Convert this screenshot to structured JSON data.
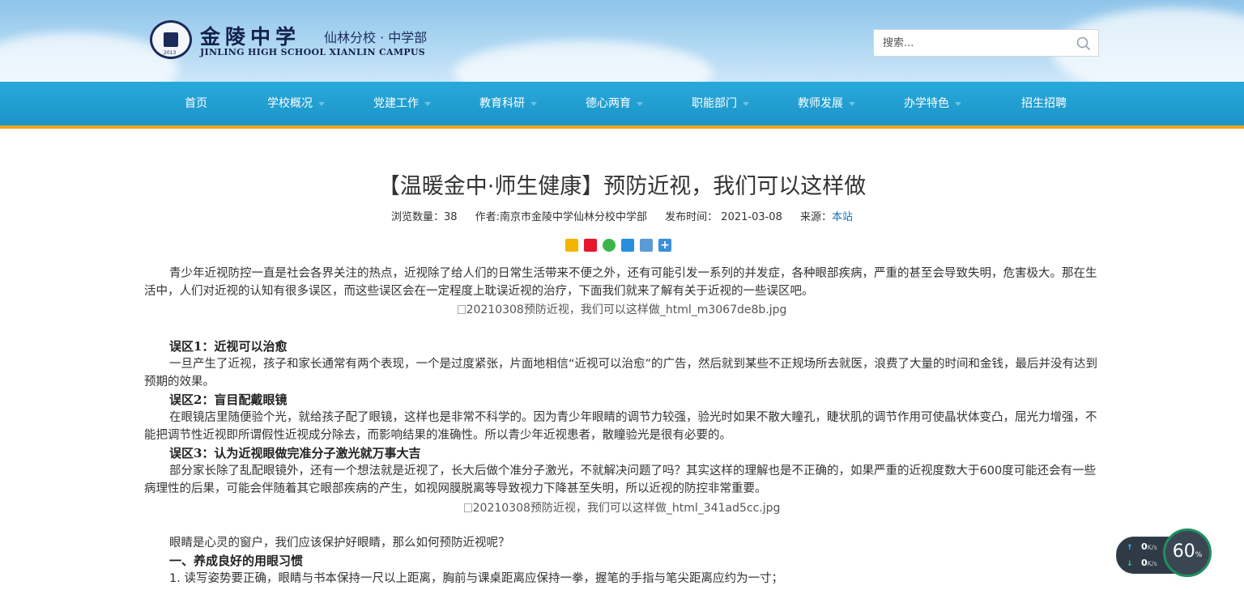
{
  "header": {
    "logo_cn": "金陵中学",
    "logo_sub": "仙林分校 · 中学部",
    "logo_en": "JINLING HIGH SCHOOL XIANLIN CAMPUS",
    "seal_year": "2013",
    "search_placeholder": "搜索..."
  },
  "nav": {
    "items": [
      {
        "label": "首页"
      },
      {
        "label": "学校概况"
      },
      {
        "label": "党建工作"
      },
      {
        "label": "教育科研"
      },
      {
        "label": "德心两育"
      },
      {
        "label": "职能部门"
      },
      {
        "label": "教师发展"
      },
      {
        "label": "办学特色"
      },
      {
        "label": "招生招聘"
      }
    ]
  },
  "article": {
    "title": "【温暖金中·师生健康】预防近视，我们可以这样做",
    "meta": {
      "views": "浏览数量：38",
      "author": "作者:南京市金陵中学仙林分校中学部",
      "date": "发布时间： 2021-03-08",
      "source_label": "来源：",
      "source_link": "本站"
    },
    "intro": "青少年近视防控一直是社会各界关注的热点，近视除了给人们的日常生活带来不便之外，还有可能引发一系列的并发症，各种眼部疾病，严重的甚至会导致失明，危害极大。那在生活中，人们对近视的认知有很多误区，而这些误区会在一定程度上耽误近视的治疗，下面我们就来了解有关于近视的一些误区吧。",
    "image1_alt": "20210308预防近视，我们可以这样做_html_m3067de8b.jpg",
    "myth1_title": "误区1：近视可以治愈",
    "myth1_text": "一旦产生了近视，孩子和家长通常有两个表现，一个是过度紧张，片面地相信“近视可以治愈”的广告，然后就到某些不正规场所去就医，浪费了大量的时间和金钱，最后并没有达到预期的效果。",
    "myth2_title": "误区2：盲目配戴眼镜",
    "myth2_text": "在眼镜店里随便验个光，就给孩子配了眼镜，这样也是非常不科学的。因为青少年眼睛的调节力较强，验光时如果不散大瞳孔，睫状肌的调节作用可使晶状体变凸，屈光力增强，不能把调节性近视即所谓假性近视成分除去，而影响结果的准确性。所以青少年近视患者，散瞳验光是很有必要的。",
    "myth3_title": "误区3：认为近视眼做完准分子激光就万事大吉",
    "myth3_text": "部分家长除了乱配眼镜外，还有一个想法就是近视了，长大后做个准分子激光，不就解决问题了吗？其实这样的理解也是不正确的，如果严重的近视度数大于600度可能还会有一些病理性的后果，可能会伴随着其它眼部疾病的产生，如视网膜脱离等导致视力下降甚至失明，所以近视的防控非常重要。",
    "image2_alt": "20210308预防近视，我们可以这样做_html_341ad5cc.jpg",
    "question": "眼睛是心灵的窗户，我们应该保护好眼睛，那么如何预防近视呢？",
    "section1_title": "一、养成良好的用眼习惯",
    "section1_item1": "1.  读写姿势要正确，眼睛与书本保持一尺以上距离，胸前与课桌距离应保持一拳，握笔的手指与笔尖距离应约为一寸；"
  },
  "speed_widget": {
    "up": "0",
    "down": "0",
    "unit": "K/s",
    "percent": "60",
    "percent_sign": "%"
  },
  "colors": {
    "nav_bg": "#1d9bd0",
    "nav_border": "#f2a21d",
    "link": "#1a6fb0"
  }
}
